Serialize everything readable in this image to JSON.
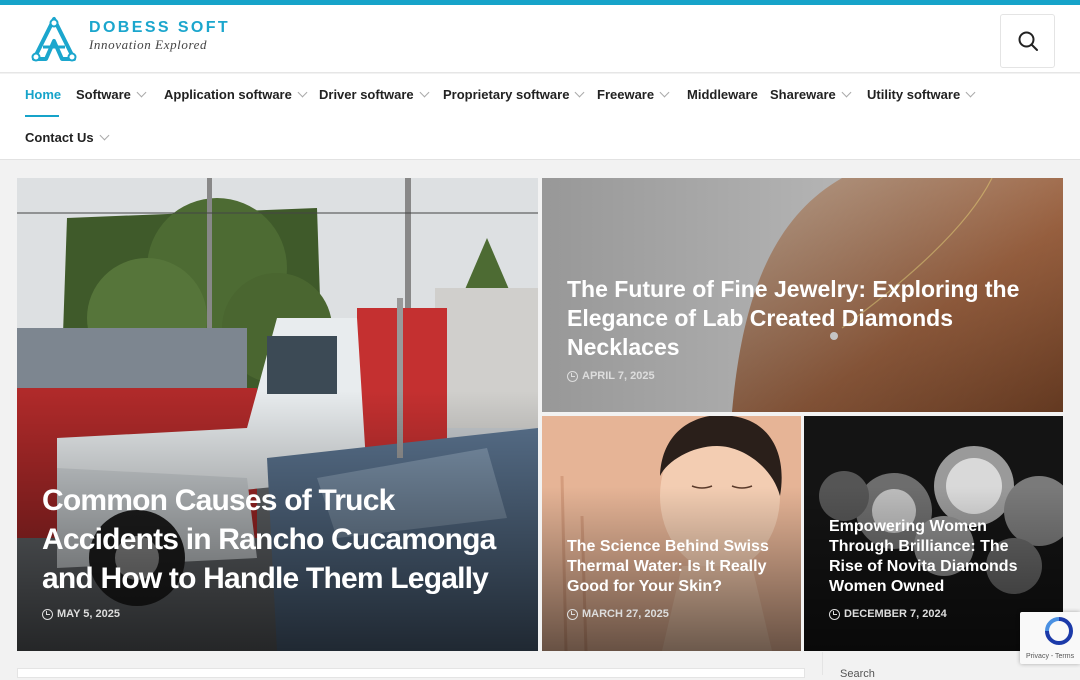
{
  "brand": {
    "name": "DOBESS SOFT",
    "tagline": "Innovation Explored"
  },
  "nav": {
    "items": [
      {
        "label": "Home",
        "active": true,
        "dropdown": false
      },
      {
        "label": "Software",
        "dropdown": true
      },
      {
        "label": "Application software",
        "dropdown": true
      },
      {
        "label": "Driver software",
        "dropdown": true
      },
      {
        "label": "Proprietary software",
        "dropdown": true
      },
      {
        "label": "Freeware",
        "dropdown": true
      },
      {
        "label": "Middleware",
        "dropdown": false
      },
      {
        "label": "Shareware",
        "dropdown": true
      },
      {
        "label": "Utility software",
        "dropdown": true
      },
      {
        "label": "Contact Us",
        "dropdown": true
      }
    ]
  },
  "featured": [
    {
      "title": "Common Causes of Truck Accidents in Rancho Cucamonga and How to Handle Them Legally",
      "date": "MAY 5, 2025"
    },
    {
      "title": "The Future of Fine Jewelry: Exploring the Elegance of Lab Created Diamonds Necklaces",
      "date": "APRIL 7, 2025"
    },
    {
      "title": "The Science Behind Swiss Thermal Water: Is It Really Good for Your Skin?",
      "date": "MARCH 27, 2025"
    },
    {
      "title": "Empowering Women Through Brilliance: The Rise of Novita Diamonds Women Owned",
      "date": "DECEMBER 7, 2024"
    }
  ],
  "sidebar": {
    "search_label": "Search"
  },
  "recaptcha": {
    "text": "Privacy - Terms"
  },
  "colors": {
    "accent": "#16a3c9",
    "nav_text": "#222222"
  }
}
